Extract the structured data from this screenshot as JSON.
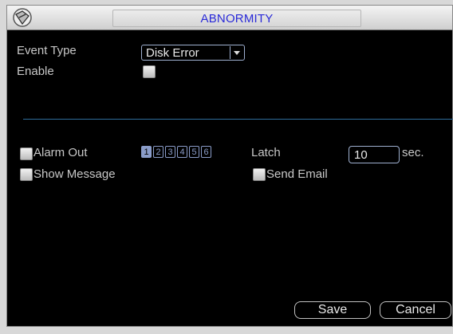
{
  "window": {
    "title": "ABNORMITY"
  },
  "form": {
    "event_type_label": "Event Type",
    "event_type_value": "Disk Error",
    "enable_label": "Enable",
    "alarm_out_label": "Alarm Out",
    "alarm_channels": [
      "1",
      "2",
      "3",
      "4",
      "5",
      "6"
    ],
    "alarm_channel_selected": "1",
    "latch_label": "Latch",
    "latch_value": "10",
    "latch_unit": "sec.",
    "show_message_label": "Show Message",
    "send_email_label": "Send Email"
  },
  "buttons": {
    "save": "Save",
    "cancel": "Cancel"
  },
  "icons": {
    "logo": "camera-logo-icon",
    "dropdown": "chevron-down-icon"
  },
  "colors": {
    "title_text": "#2a2ad8",
    "divider": "#2f6d9c",
    "label_text": "#c8c8c8"
  }
}
